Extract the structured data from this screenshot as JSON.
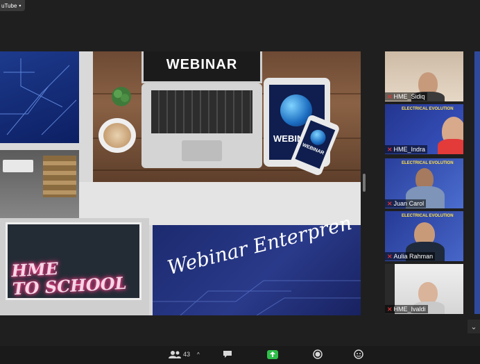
{
  "top_badge": {
    "label": "uTube",
    "caret": "▾"
  },
  "slides": {
    "laptop_label": "WEBINAR",
    "tablet_label": "WEBIN",
    "phone_label": "WEBINAR",
    "board_text": "HME\nTO SCHOOL",
    "banner_text": "Webinar Enterpren"
  },
  "participants": [
    {
      "name": "HME_Sidiq",
      "muted": true
    },
    {
      "name": "HME_Indra",
      "muted": true
    },
    {
      "name": "Juan Carol",
      "muted": true
    },
    {
      "name": "Aulia Rahman",
      "muted": true
    },
    {
      "name": "HME_Ivaldi",
      "muted": true
    }
  ],
  "tile_banner_text": "ELECTRICAL EVOLUTION",
  "toolbar": {
    "participants_count": "43"
  },
  "colors": {
    "accent_green": "#2fbf4a",
    "mute_red": "#e23434"
  }
}
